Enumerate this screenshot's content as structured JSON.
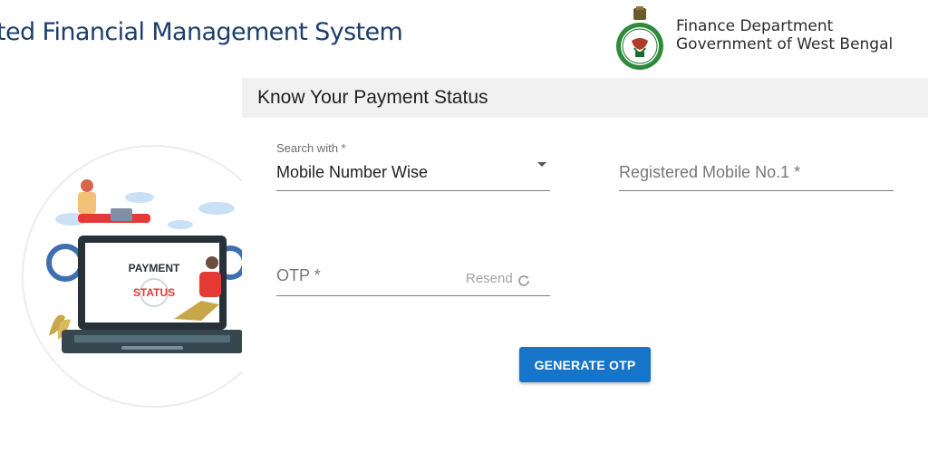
{
  "header": {
    "title": "ted Financial Management System",
    "dept_line1": "Finance Department",
    "dept_line2": "Government of West Bengal"
  },
  "illustration": {
    "text_line1": "PAYMENT",
    "text_line2": "STATUS"
  },
  "card": {
    "title": "Know Your Payment Status",
    "search_with": {
      "label": "Search with *",
      "value": "Mobile Number Wise"
    },
    "mobile_field": {
      "placeholder": "Registered Mobile No.1 *"
    },
    "otp_field": {
      "placeholder": "OTP *",
      "resend_label": "Resend"
    },
    "generate_button_label": "GENERATE OTP"
  },
  "colors": {
    "brand_blue": "#1d3f6b",
    "button_blue": "#1675c9",
    "emblem_green": "#2e8b3a",
    "status_red": "#e53935"
  }
}
